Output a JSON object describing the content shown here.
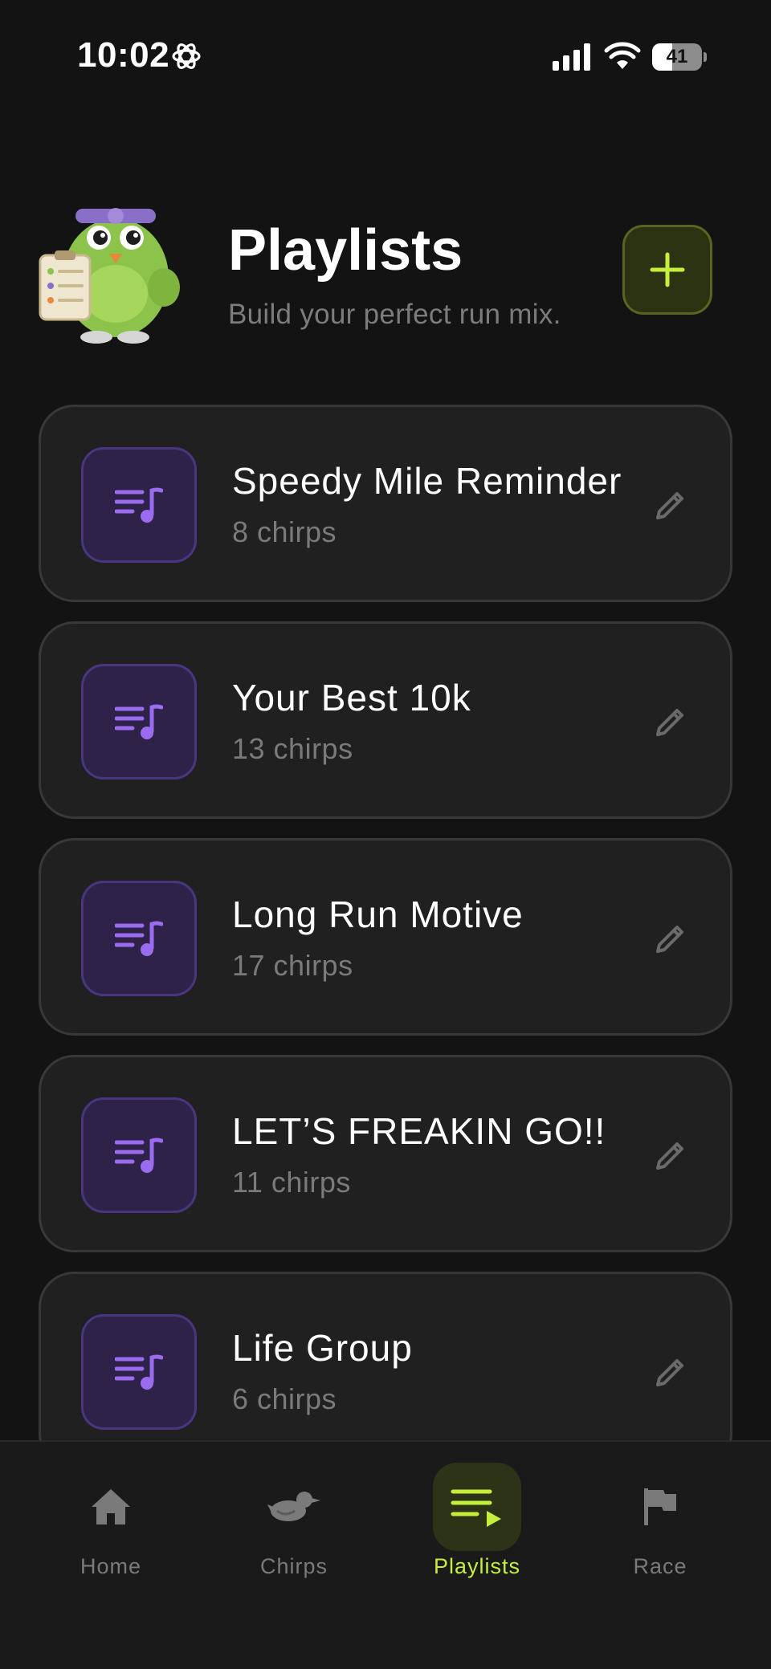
{
  "status_bar": {
    "time": "10:02",
    "battery_level": "41",
    "icons": [
      "gear-icon",
      "signal-icon",
      "wifi-icon",
      "battery-icon"
    ]
  },
  "header": {
    "title": "Playlists",
    "subtitle": "Build your perfect run mix.",
    "add_button_icon": "plus-icon"
  },
  "playlists": [
    {
      "name": "Speedy Mile Reminder",
      "count": "8 chirps"
    },
    {
      "name": "Your Best 10k",
      "count": "13 chirps"
    },
    {
      "name": "Long Run Motive",
      "count": "17 chirps"
    },
    {
      "name": "LET’S FREAKIN GO!!",
      "count": "11 chirps"
    },
    {
      "name": "Life Group",
      "count": "6 chirps"
    }
  ],
  "tab_bar": {
    "tabs": [
      {
        "label": "Home",
        "icon": "home-icon",
        "active": false
      },
      {
        "label": "Chirps",
        "icon": "bird-icon",
        "active": false
      },
      {
        "label": "Playlists",
        "icon": "playlist-icon",
        "active": true
      },
      {
        "label": "Race",
        "icon": "flag-icon",
        "active": false
      }
    ]
  },
  "colors": {
    "background": "#131313",
    "card": "#202020",
    "accent": "#c6ef3d",
    "playlist_icon": "#9b6cf0"
  }
}
